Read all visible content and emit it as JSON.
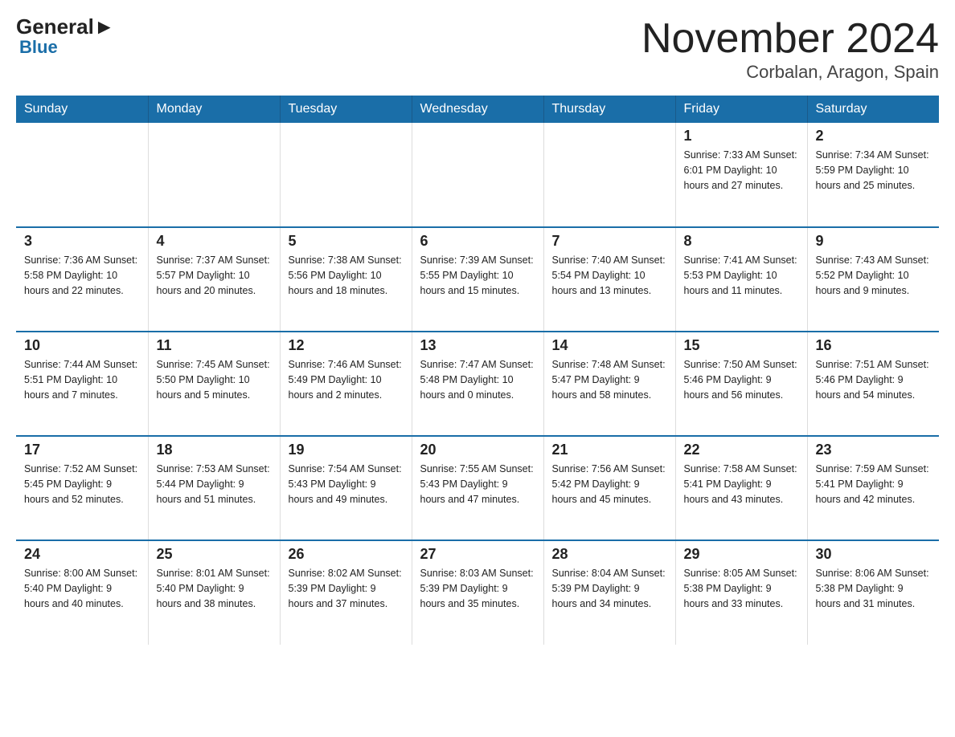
{
  "logo": {
    "general": "General",
    "blue": "Blue"
  },
  "title": "November 2024",
  "subtitle": "Corbalan, Aragon, Spain",
  "days_of_week": [
    "Sunday",
    "Monday",
    "Tuesday",
    "Wednesday",
    "Thursday",
    "Friday",
    "Saturday"
  ],
  "weeks": [
    {
      "days": [
        {
          "num": "",
          "info": ""
        },
        {
          "num": "",
          "info": ""
        },
        {
          "num": "",
          "info": ""
        },
        {
          "num": "",
          "info": ""
        },
        {
          "num": "",
          "info": ""
        },
        {
          "num": "1",
          "info": "Sunrise: 7:33 AM\nSunset: 6:01 PM\nDaylight: 10 hours and 27 minutes."
        },
        {
          "num": "2",
          "info": "Sunrise: 7:34 AM\nSunset: 5:59 PM\nDaylight: 10 hours and 25 minutes."
        }
      ]
    },
    {
      "days": [
        {
          "num": "3",
          "info": "Sunrise: 7:36 AM\nSunset: 5:58 PM\nDaylight: 10 hours and 22 minutes."
        },
        {
          "num": "4",
          "info": "Sunrise: 7:37 AM\nSunset: 5:57 PM\nDaylight: 10 hours and 20 minutes."
        },
        {
          "num": "5",
          "info": "Sunrise: 7:38 AM\nSunset: 5:56 PM\nDaylight: 10 hours and 18 minutes."
        },
        {
          "num": "6",
          "info": "Sunrise: 7:39 AM\nSunset: 5:55 PM\nDaylight: 10 hours and 15 minutes."
        },
        {
          "num": "7",
          "info": "Sunrise: 7:40 AM\nSunset: 5:54 PM\nDaylight: 10 hours and 13 minutes."
        },
        {
          "num": "8",
          "info": "Sunrise: 7:41 AM\nSunset: 5:53 PM\nDaylight: 10 hours and 11 minutes."
        },
        {
          "num": "9",
          "info": "Sunrise: 7:43 AM\nSunset: 5:52 PM\nDaylight: 10 hours and 9 minutes."
        }
      ]
    },
    {
      "days": [
        {
          "num": "10",
          "info": "Sunrise: 7:44 AM\nSunset: 5:51 PM\nDaylight: 10 hours and 7 minutes."
        },
        {
          "num": "11",
          "info": "Sunrise: 7:45 AM\nSunset: 5:50 PM\nDaylight: 10 hours and 5 minutes."
        },
        {
          "num": "12",
          "info": "Sunrise: 7:46 AM\nSunset: 5:49 PM\nDaylight: 10 hours and 2 minutes."
        },
        {
          "num": "13",
          "info": "Sunrise: 7:47 AM\nSunset: 5:48 PM\nDaylight: 10 hours and 0 minutes."
        },
        {
          "num": "14",
          "info": "Sunrise: 7:48 AM\nSunset: 5:47 PM\nDaylight: 9 hours and 58 minutes."
        },
        {
          "num": "15",
          "info": "Sunrise: 7:50 AM\nSunset: 5:46 PM\nDaylight: 9 hours and 56 minutes."
        },
        {
          "num": "16",
          "info": "Sunrise: 7:51 AM\nSunset: 5:46 PM\nDaylight: 9 hours and 54 minutes."
        }
      ]
    },
    {
      "days": [
        {
          "num": "17",
          "info": "Sunrise: 7:52 AM\nSunset: 5:45 PM\nDaylight: 9 hours and 52 minutes."
        },
        {
          "num": "18",
          "info": "Sunrise: 7:53 AM\nSunset: 5:44 PM\nDaylight: 9 hours and 51 minutes."
        },
        {
          "num": "19",
          "info": "Sunrise: 7:54 AM\nSunset: 5:43 PM\nDaylight: 9 hours and 49 minutes."
        },
        {
          "num": "20",
          "info": "Sunrise: 7:55 AM\nSunset: 5:43 PM\nDaylight: 9 hours and 47 minutes."
        },
        {
          "num": "21",
          "info": "Sunrise: 7:56 AM\nSunset: 5:42 PM\nDaylight: 9 hours and 45 minutes."
        },
        {
          "num": "22",
          "info": "Sunrise: 7:58 AM\nSunset: 5:41 PM\nDaylight: 9 hours and 43 minutes."
        },
        {
          "num": "23",
          "info": "Sunrise: 7:59 AM\nSunset: 5:41 PM\nDaylight: 9 hours and 42 minutes."
        }
      ]
    },
    {
      "days": [
        {
          "num": "24",
          "info": "Sunrise: 8:00 AM\nSunset: 5:40 PM\nDaylight: 9 hours and 40 minutes."
        },
        {
          "num": "25",
          "info": "Sunrise: 8:01 AM\nSunset: 5:40 PM\nDaylight: 9 hours and 38 minutes."
        },
        {
          "num": "26",
          "info": "Sunrise: 8:02 AM\nSunset: 5:39 PM\nDaylight: 9 hours and 37 minutes."
        },
        {
          "num": "27",
          "info": "Sunrise: 8:03 AM\nSunset: 5:39 PM\nDaylight: 9 hours and 35 minutes."
        },
        {
          "num": "28",
          "info": "Sunrise: 8:04 AM\nSunset: 5:39 PM\nDaylight: 9 hours and 34 minutes."
        },
        {
          "num": "29",
          "info": "Sunrise: 8:05 AM\nSunset: 5:38 PM\nDaylight: 9 hours and 33 minutes."
        },
        {
          "num": "30",
          "info": "Sunrise: 8:06 AM\nSunset: 5:38 PM\nDaylight: 9 hours and 31 minutes."
        }
      ]
    }
  ]
}
